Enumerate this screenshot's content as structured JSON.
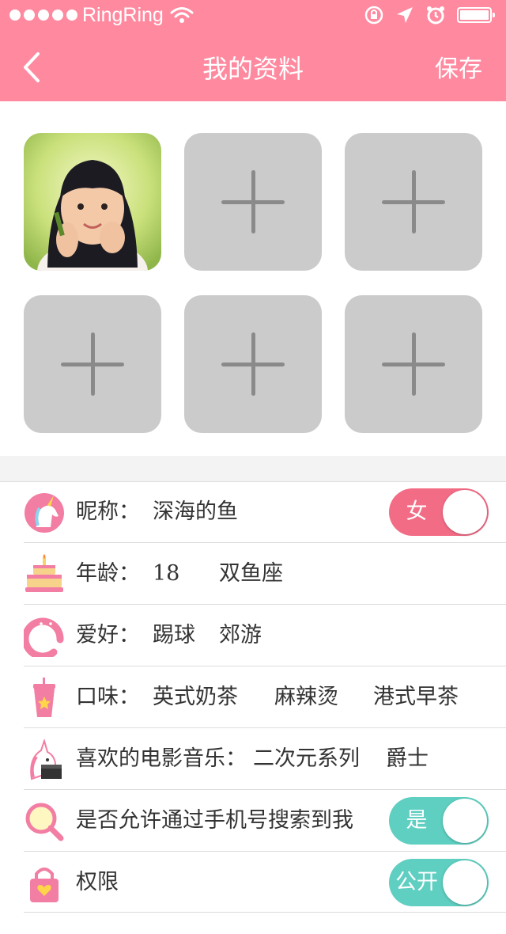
{
  "status_bar": {
    "carrier": "RingRing"
  },
  "nav": {
    "title": "我的资料",
    "save_label": "保存"
  },
  "photos": {
    "add_slots": 5
  },
  "profile": {
    "nickname": {
      "label": "昵称：",
      "value": "深海的鱼",
      "gender_toggle": "女"
    },
    "age": {
      "label": "年龄：",
      "value": "18",
      "zodiac": "双鱼座"
    },
    "hobby": {
      "label": "爱好：",
      "values": [
        "踢球",
        "郊游"
      ]
    },
    "taste": {
      "label": "口味：",
      "values": [
        "英式奶茶",
        "麻辣烫",
        "港式早茶"
      ]
    },
    "movie_music": {
      "label": "喜欢的电影音乐：",
      "values": [
        "二次元系列",
        "爵士"
      ]
    },
    "phone_search": {
      "label": "是否允许通过手机号搜索到我",
      "toggle": "是"
    },
    "permission": {
      "label": "权限",
      "toggle": "公开"
    }
  },
  "colors": {
    "header": "#ff8aa0",
    "pink_toggle": "#f36c86",
    "teal_toggle": "#5ecfc1",
    "add_slot": "#cbcbcb"
  }
}
